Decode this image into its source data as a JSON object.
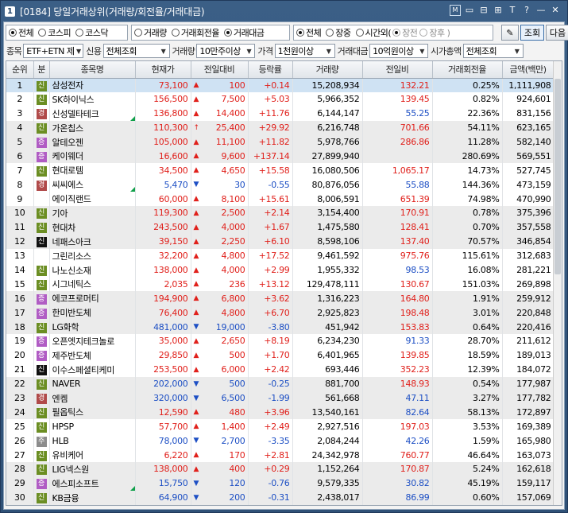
{
  "window": {
    "number": "1",
    "title": "[0184] 당일거래상위(거래량/회전율/거래대금)",
    "buttons": [
      "M",
      "▭",
      "⊟",
      "⊞",
      "T",
      "?",
      "—",
      "✕"
    ]
  },
  "market_filter": {
    "options": [
      "전체",
      "코스피",
      "코스닥"
    ],
    "selected": "전체"
  },
  "sort_filter": {
    "options": [
      "거래량",
      "거래회전율",
      "거래대금"
    ],
    "selected": "거래대금"
  },
  "session_filter": {
    "options": [
      "전체",
      "장중",
      "시간외(",
      "장전",
      "장후 )"
    ],
    "selected": "전체"
  },
  "buttons": {
    "search": "조회",
    "next": "다음"
  },
  "filters": {
    "item_label": "종목",
    "item_value": "ETF+ETN 제",
    "credit_label": "신용",
    "credit_value": "전체조회",
    "volume_label": "거래량",
    "volume_value": "10만주이상",
    "price_label": "가격",
    "price_value": "1천원이상",
    "amount_label": "거래대금",
    "amount_value": "10억원이상",
    "cap_label": "시가총액",
    "cap_value": "전체조회"
  },
  "columns": [
    "순위",
    "분",
    "종목명",
    "현재가",
    "전일대비",
    "등락률",
    "거래량",
    "전일비",
    "거래회전율",
    "금액(백만)"
  ],
  "badge_colors": {
    "신": "#6b8e23",
    "증": "#b05cc4",
    "경": "#b04a4a",
    "주": "#8c8c8c",
    "신black": "#111111"
  },
  "rows": [
    {
      "rank": "1",
      "badge": "신",
      "bc": "#6b8e23",
      "name": "삼성전자",
      "price": "73,100",
      "dir": "up",
      "diff": "100",
      "rate": "+0.14",
      "vol": "15,208,934",
      "prev": "132.21",
      "pdir": "up",
      "turn": "0.25%",
      "amt": "1,111,908",
      "flag": false
    },
    {
      "rank": "2",
      "badge": "신",
      "bc": "#6b8e23",
      "name": "SK하이닉스",
      "price": "156,500",
      "dir": "up",
      "diff": "7,500",
      "rate": "+5.03",
      "vol": "5,966,352",
      "prev": "139.45",
      "pdir": "up",
      "turn": "0.82%",
      "amt": "924,601",
      "flag": false
    },
    {
      "rank": "3",
      "badge": "경",
      "bc": "#b04a4a",
      "name": "신성델타테크",
      "price": "136,800",
      "dir": "up",
      "diff": "14,400",
      "rate": "+11.76",
      "vol": "6,144,147",
      "prev": "55.25",
      "pdir": "dn",
      "turn": "22.36%",
      "amt": "831,156",
      "flag": true
    },
    {
      "rank": "4",
      "badge": "신",
      "bc": "#6b8e23",
      "name": "가온칩스",
      "price": "110,300",
      "dir": "upper",
      "diff": "25,400",
      "rate": "+29.92",
      "vol": "6,216,748",
      "prev": "701.66",
      "pdir": "up",
      "turn": "54.11%",
      "amt": "623,165",
      "flag": false
    },
    {
      "rank": "5",
      "badge": "증",
      "bc": "#b05cc4",
      "name": "알테오젠",
      "price": "105,000",
      "dir": "up",
      "diff": "11,100",
      "rate": "+11.82",
      "vol": "5,978,766",
      "prev": "286.86",
      "pdir": "up",
      "turn": "11.28%",
      "amt": "582,140",
      "flag": false
    },
    {
      "rank": "6",
      "badge": "증",
      "bc": "#b05cc4",
      "name": "케이웨더",
      "price": "16,600",
      "dir": "up",
      "diff": "9,600",
      "rate": "+137.14",
      "vol": "27,899,940",
      "prev": "",
      "pdir": "up",
      "turn": "280.69%",
      "amt": "569,551",
      "flag": false
    },
    {
      "rank": "7",
      "badge": "신",
      "bc": "#6b8e23",
      "name": "현대로템",
      "price": "34,500",
      "dir": "up",
      "diff": "4,650",
      "rate": "+15.58",
      "vol": "16,080,506",
      "prev": "1,065.17",
      "pdir": "up",
      "turn": "14.73%",
      "amt": "527,745",
      "flag": false
    },
    {
      "rank": "8",
      "badge": "경",
      "bc": "#b04a4a",
      "name": "씨씨에스",
      "price": "5,470",
      "dir": "dn",
      "diff": "30",
      "rate": "-0.55",
      "vol": "80,876,056",
      "prev": "55.88",
      "pdir": "dn",
      "turn": "144.36%",
      "amt": "473,159",
      "flag": true
    },
    {
      "rank": "9",
      "badge": "",
      "bc": "",
      "name": "에이직랜드",
      "price": "60,000",
      "dir": "up",
      "diff": "8,100",
      "rate": "+15.61",
      "vol": "8,006,591",
      "prev": "651.39",
      "pdir": "up",
      "turn": "74.98%",
      "amt": "470,990",
      "flag": false
    },
    {
      "rank": "10",
      "badge": "신",
      "bc": "#6b8e23",
      "name": "기아",
      "price": "119,300",
      "dir": "up",
      "diff": "2,500",
      "rate": "+2.14",
      "vol": "3,154,400",
      "prev": "170.91",
      "pdir": "up",
      "turn": "0.78%",
      "amt": "375,396",
      "flag": false
    },
    {
      "rank": "11",
      "badge": "신",
      "bc": "#6b8e23",
      "name": "현대차",
      "price": "243,500",
      "dir": "up",
      "diff": "4,000",
      "rate": "+1.67",
      "vol": "1,475,580",
      "prev": "128.41",
      "pdir": "up",
      "turn": "0.70%",
      "amt": "357,558",
      "flag": false
    },
    {
      "rank": "12",
      "badge": "신",
      "bc": "#111111",
      "name": "네패스아크",
      "price": "39,150",
      "dir": "up",
      "diff": "2,250",
      "rate": "+6.10",
      "vol": "8,598,106",
      "prev": "137.40",
      "pdir": "up",
      "turn": "70.57%",
      "amt": "346,854",
      "flag": false
    },
    {
      "rank": "13",
      "badge": "",
      "bc": "",
      "name": "그린리소스",
      "price": "32,200",
      "dir": "up",
      "diff": "4,800",
      "rate": "+17.52",
      "vol": "9,461,592",
      "prev": "975.76",
      "pdir": "up",
      "turn": "115.61%",
      "amt": "312,683",
      "flag": false
    },
    {
      "rank": "14",
      "badge": "신",
      "bc": "#6b8e23",
      "name": "나노신소재",
      "price": "138,000",
      "dir": "up",
      "diff": "4,000",
      "rate": "+2.99",
      "vol": "1,955,332",
      "prev": "98.53",
      "pdir": "dn",
      "turn": "16.08%",
      "amt": "281,221",
      "flag": false
    },
    {
      "rank": "15",
      "badge": "신",
      "bc": "#6b8e23",
      "name": "시그네틱스",
      "price": "2,035",
      "dir": "up",
      "diff": "236",
      "rate": "+13.12",
      "vol": "129,478,111",
      "prev": "130.67",
      "pdir": "up",
      "turn": "151.03%",
      "amt": "269,898",
      "flag": false
    },
    {
      "rank": "16",
      "badge": "증",
      "bc": "#b05cc4",
      "name": "에코프로머티",
      "price": "194,900",
      "dir": "up",
      "diff": "6,800",
      "rate": "+3.62",
      "vol": "1,316,223",
      "prev": "164.80",
      "pdir": "up",
      "turn": "1.91%",
      "amt": "259,912",
      "flag": false
    },
    {
      "rank": "17",
      "badge": "증",
      "bc": "#b05cc4",
      "name": "한미반도체",
      "price": "76,400",
      "dir": "up",
      "diff": "4,800",
      "rate": "+6.70",
      "vol": "2,925,823",
      "prev": "198.48",
      "pdir": "up",
      "turn": "3.01%",
      "amt": "220,848",
      "flag": false
    },
    {
      "rank": "18",
      "badge": "신",
      "bc": "#6b8e23",
      "name": "LG화학",
      "price": "481,000",
      "dir": "dn",
      "diff": "19,000",
      "rate": "-3.80",
      "vol": "451,942",
      "prev": "153.83",
      "pdir": "up",
      "turn": "0.64%",
      "amt": "220,416",
      "flag": false
    },
    {
      "rank": "19",
      "badge": "증",
      "bc": "#b05cc4",
      "name": "오픈엣지테크놀로",
      "price": "35,000",
      "dir": "up",
      "diff": "2,650",
      "rate": "+8.19",
      "vol": "6,234,230",
      "prev": "91.33",
      "pdir": "dn",
      "turn": "28.70%",
      "amt": "211,612",
      "flag": false
    },
    {
      "rank": "20",
      "badge": "증",
      "bc": "#b05cc4",
      "name": "제주반도체",
      "price": "29,850",
      "dir": "up",
      "diff": "500",
      "rate": "+1.70",
      "vol": "6,401,965",
      "prev": "139.85",
      "pdir": "up",
      "turn": "18.59%",
      "amt": "189,013",
      "flag": false
    },
    {
      "rank": "21",
      "badge": "신",
      "bc": "#111111",
      "name": "이수스페셜티케미",
      "price": "253,500",
      "dir": "up",
      "diff": "6,000",
      "rate": "+2.42",
      "vol": "693,446",
      "prev": "352.23",
      "pdir": "up",
      "turn": "12.39%",
      "amt": "184,072",
      "flag": false
    },
    {
      "rank": "22",
      "badge": "신",
      "bc": "#6b8e23",
      "name": "NAVER",
      "price": "202,000",
      "dir": "dn",
      "diff": "500",
      "rate": "-0.25",
      "vol": "881,700",
      "prev": "148.93",
      "pdir": "up",
      "turn": "0.54%",
      "amt": "177,987",
      "flag": false
    },
    {
      "rank": "23",
      "badge": "경",
      "bc": "#b04a4a",
      "name": "엔켐",
      "price": "320,000",
      "dir": "dn",
      "diff": "6,500",
      "rate": "-1.99",
      "vol": "561,668",
      "prev": "47.11",
      "pdir": "dn",
      "turn": "3.27%",
      "amt": "177,782",
      "flag": false
    },
    {
      "rank": "24",
      "badge": "신",
      "bc": "#6b8e23",
      "name": "필옵틱스",
      "price": "12,590",
      "dir": "up",
      "diff": "480",
      "rate": "+3.96",
      "vol": "13,540,161",
      "prev": "82.64",
      "pdir": "dn",
      "turn": "58.13%",
      "amt": "172,897",
      "flag": false
    },
    {
      "rank": "25",
      "badge": "신",
      "bc": "#6b8e23",
      "name": "HPSP",
      "price": "57,700",
      "dir": "up",
      "diff": "1,400",
      "rate": "+2.49",
      "vol": "2,927,516",
      "prev": "197.03",
      "pdir": "up",
      "turn": "3.53%",
      "amt": "169,389",
      "flag": false
    },
    {
      "rank": "26",
      "badge": "주",
      "bc": "#8c8c8c",
      "name": "HLB",
      "price": "78,000",
      "dir": "dn",
      "diff": "2,700",
      "rate": "-3.35",
      "vol": "2,084,244",
      "prev": "42.26",
      "pdir": "dn",
      "turn": "1.59%",
      "amt": "165,980",
      "flag": false
    },
    {
      "rank": "27",
      "badge": "신",
      "bc": "#6b8e23",
      "name": "유비케어",
      "price": "6,220",
      "dir": "up",
      "diff": "170",
      "rate": "+2.81",
      "vol": "24,342,978",
      "prev": "760.77",
      "pdir": "up",
      "turn": "46.64%",
      "amt": "163,073",
      "flag": false
    },
    {
      "rank": "28",
      "badge": "신",
      "bc": "#6b8e23",
      "name": "LIG넥스원",
      "price": "138,000",
      "dir": "up",
      "diff": "400",
      "rate": "+0.29",
      "vol": "1,152,264",
      "prev": "170.87",
      "pdir": "up",
      "turn": "5.24%",
      "amt": "162,618",
      "flag": false
    },
    {
      "rank": "29",
      "badge": "증",
      "bc": "#b05cc4",
      "name": "에스피소프트",
      "price": "15,750",
      "dir": "dn",
      "diff": "120",
      "rate": "-0.76",
      "vol": "9,579,335",
      "prev": "30.82",
      "pdir": "dn",
      "turn": "45.19%",
      "amt": "159,117",
      "flag": true
    },
    {
      "rank": "30",
      "badge": "신",
      "bc": "#6b8e23",
      "name": "KB금융",
      "price": "64,900",
      "dir": "dn",
      "diff": "200",
      "rate": "-0.31",
      "vol": "2,438,017",
      "prev": "86.99",
      "pdir": "dn",
      "turn": "0.60%",
      "amt": "157,069",
      "flag": false
    }
  ]
}
